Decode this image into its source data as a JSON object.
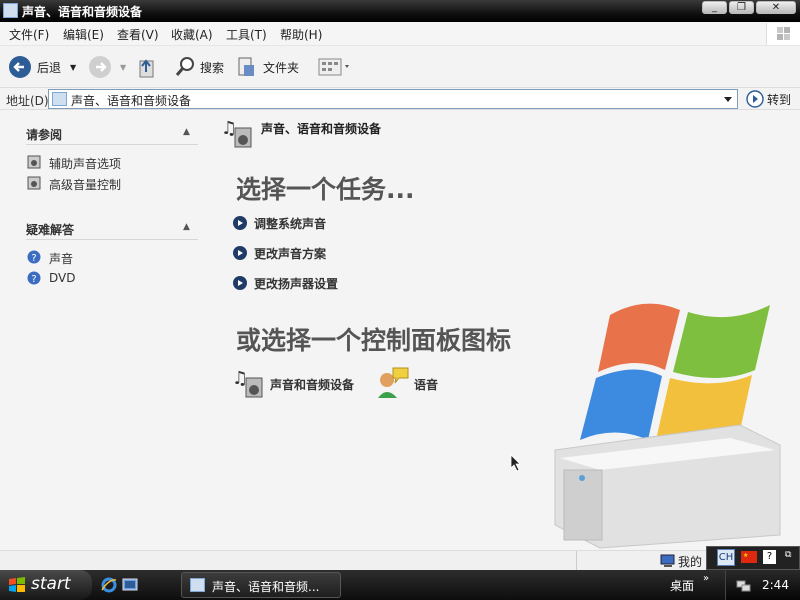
{
  "window": {
    "title": "声音、语音和音频设备"
  },
  "menu": [
    "文件(F)",
    "编辑(E)",
    "查看(V)",
    "收藏(A)",
    "工具(T)",
    "帮助(H)"
  ],
  "toolbar": {
    "back_label": "后退",
    "search_label": "搜索",
    "folders_label": "文件夹"
  },
  "address": {
    "label": "地址(D)",
    "value": "声音、语音和音频设备",
    "go_label": "转到"
  },
  "left": {
    "see_also": {
      "title": "请参阅",
      "items": [
        "辅助声音选项",
        "高级音量控制"
      ]
    },
    "troubleshoot": {
      "title": "疑难解答",
      "items": [
        "声音",
        "DVD"
      ]
    }
  },
  "main": {
    "category_title": "声音、语音和音频设备",
    "pick_task": "选择一个任务...",
    "tasks": [
      "调整系统声音",
      "更改声音方案",
      "更改扬声器设置"
    ],
    "pick_icon": "或选择一个控制面板图标",
    "icons": [
      "声音和音频设备",
      "语音"
    ]
  },
  "status": {
    "right_text": "我的"
  },
  "taskbar": {
    "start_label": "start",
    "task_label": "声音、语音和音频...",
    "desktop_label": "桌面",
    "ime_label": "CH",
    "clock": "2:44"
  },
  "colors": {
    "accent": "#1f3b66",
    "title_bar": "#111111"
  }
}
